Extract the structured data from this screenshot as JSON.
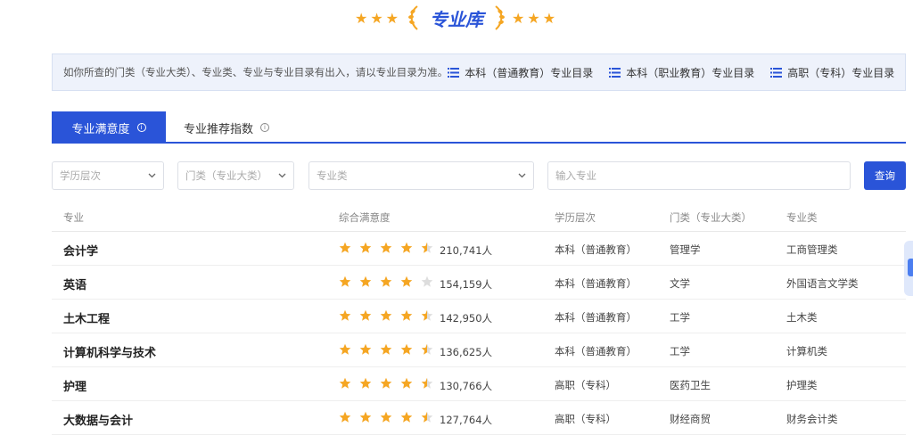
{
  "header": {
    "title": "专业库",
    "left_stars": "★★★",
    "right_stars": "★★★"
  },
  "notice": {
    "text": "如你所查的门类（专业大类）、专业类、专业与专业目录有出入，请以专业目录为准。",
    "links": [
      {
        "label": "本科（普通教育）专业目录",
        "icon": "list-icon"
      },
      {
        "label": "本科（职业教育）专业目录",
        "icon": "list-icon"
      },
      {
        "label": "高职（专科）专业目录",
        "icon": "list-icon"
      }
    ]
  },
  "tabs": [
    {
      "label": "专业满意度",
      "active": true,
      "icon": "info-icon",
      "icon_glyph": "i"
    },
    {
      "label": "专业推荐指数",
      "active": false,
      "icon": "info-icon",
      "icon_glyph": "i"
    }
  ],
  "filters": {
    "education_level": {
      "placeholder": "学历层次"
    },
    "category": {
      "placeholder": "门类（专业大类）"
    },
    "major_class": {
      "placeholder": "专业类"
    },
    "major_input": {
      "placeholder": "输入专业"
    },
    "search_label": "查询"
  },
  "table": {
    "headers": [
      "专业",
      "综合满意度",
      "学历层次",
      "门类（专业大类）",
      "专业类"
    ],
    "rows": [
      {
        "major": "会计学",
        "rating": 4.5,
        "count": "210,741人",
        "level": "本科（普通教育）",
        "category": "管理学",
        "class": "工商管理类"
      },
      {
        "major": "英语",
        "rating": 4.0,
        "count": "154,159人",
        "level": "本科（普通教育）",
        "category": "文学",
        "class": "外国语言文学类"
      },
      {
        "major": "土木工程",
        "rating": 4.5,
        "count": "142,950人",
        "level": "本科（普通教育）",
        "category": "工学",
        "class": "土木类"
      },
      {
        "major": "计算机科学与技术",
        "rating": 4.5,
        "count": "136,625人",
        "level": "本科（普通教育）",
        "category": "工学",
        "class": "计算机类"
      },
      {
        "major": "护理",
        "rating": 4.5,
        "count": "130,766人",
        "level": "高职（专科）",
        "category": "医药卫生",
        "class": "护理类"
      },
      {
        "major": "大数据与会计",
        "rating": 4.5,
        "count": "127,764人",
        "level": "高职（专科）",
        "category": "财经商贸",
        "class": "财务会计类"
      }
    ]
  },
  "colors": {
    "accent": "#2a54d8",
    "star": "#f5a623",
    "star_empty": "#dddddd"
  }
}
